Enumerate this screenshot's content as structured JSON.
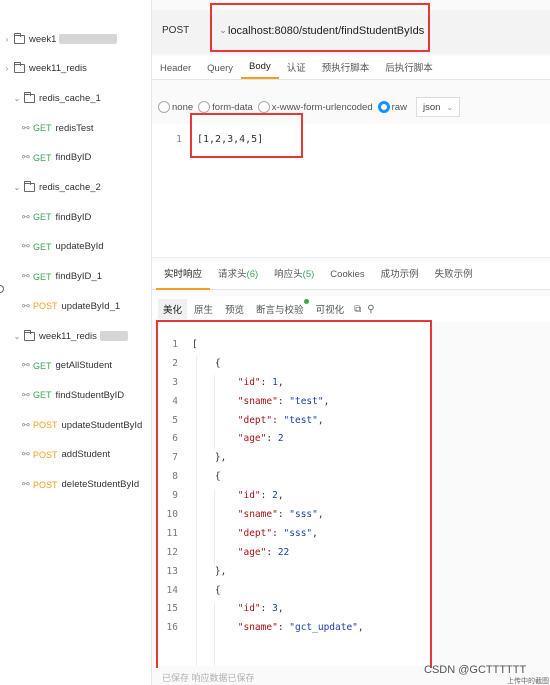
{
  "sidebar": {
    "items": [
      {
        "kind": "folder",
        "label": "week1",
        "chev": "›",
        "blurred": true
      },
      {
        "kind": "folder",
        "label": "week11_redis",
        "chev": "›"
      },
      {
        "kind": "folder",
        "label": "redis_cache_1",
        "chev": "⌄"
      },
      {
        "kind": "request",
        "method": "GET",
        "label": "redisTest"
      },
      {
        "kind": "request",
        "method": "GET",
        "label": "findByID"
      },
      {
        "kind": "folder",
        "label": "redis_cache_2",
        "chev": "⌄"
      },
      {
        "kind": "request",
        "method": "GET",
        "label": "findByID"
      },
      {
        "kind": "request",
        "method": "GET",
        "label": "updateById"
      },
      {
        "kind": "request",
        "method": "GET",
        "label": "findByID_1"
      },
      {
        "kind": "request",
        "method": "POST",
        "label": "updateById_1"
      },
      {
        "kind": "folder",
        "label": "week11_redis",
        "chev": "⌄",
        "blurred": true
      },
      {
        "kind": "request",
        "method": "GET",
        "label": "getAllStudent"
      },
      {
        "kind": "request",
        "method": "GET",
        "label": "findStudentByID"
      },
      {
        "kind": "request",
        "method": "POST",
        "label": "updateStudentById"
      },
      {
        "kind": "request",
        "method": "POST",
        "label": "addStudent"
      },
      {
        "kind": "request",
        "method": "POST",
        "label": "deleteStudentById"
      }
    ]
  },
  "request": {
    "method": "POST",
    "url": "localhost:8080/student/findStudentByIds",
    "tabs": [
      "Header",
      "Query",
      "Body",
      "认证",
      "预执行脚本",
      "后执行脚本"
    ],
    "active_tab": "Body",
    "body_types": [
      "none",
      "form-data",
      "x-www-form-urlencoded",
      "raw"
    ],
    "selected_body_type": "raw",
    "format": "json",
    "body_line_number": "1",
    "body": "[1,2,3,4,5]"
  },
  "response": {
    "tabs": [
      {
        "label": "实时响应"
      },
      {
        "label": "请求头",
        "count": "(6)"
      },
      {
        "label": "响应头",
        "count": "(5)"
      },
      {
        "label": "Cookies"
      },
      {
        "label": "成功示例"
      },
      {
        "label": "失败示例"
      }
    ],
    "tools": [
      "美化",
      "原生",
      "预览",
      "断言与校验",
      "可视化"
    ],
    "active_tool": "美化",
    "lines": [
      "[",
      "    {",
      "        \"id\": 1,",
      "        \"sname\": \"test\",",
      "        \"dept\": \"test\",",
      "        \"age\": 2",
      "    },",
      "    {",
      "        \"id\": 2,",
      "        \"sname\": \"sss\",",
      "        \"dept\": \"sss\",",
      "        \"age\": 22",
      "    },",
      "    {",
      "        \"id\": 3,",
      "        \"sname\": \"gct_update\","
    ]
  },
  "footer": {
    "faded": "已保存    响应数据已保存",
    "watermark": "CSDN @GCTTTTTT",
    "watermark_small": "上传中的截图"
  },
  "colors": {
    "get": "#3aa655",
    "post": "#f0a020",
    "highlight": "#e53935",
    "accent": "#1890ff"
  }
}
